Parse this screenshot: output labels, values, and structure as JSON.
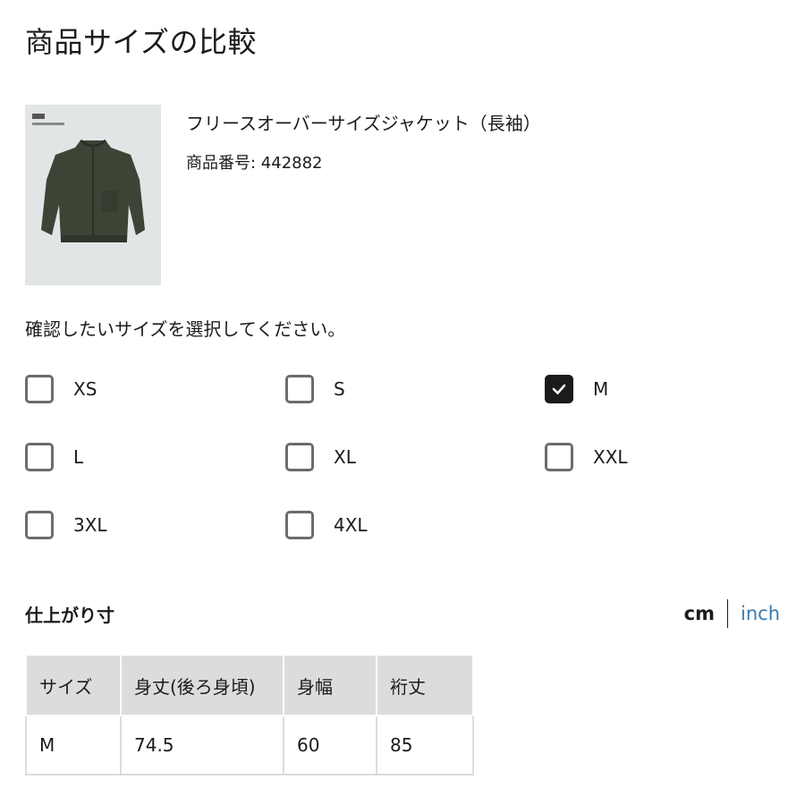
{
  "page": {
    "title": "商品サイズの比較"
  },
  "product": {
    "name": "フリースオーバーサイズジャケット（長袖）",
    "number_label": "商品番号: 442882"
  },
  "selector": {
    "prompt": "確認したいサイズを選択してください。",
    "sizes": [
      {
        "label": "XS",
        "checked": false
      },
      {
        "label": "S",
        "checked": false
      },
      {
        "label": "M",
        "checked": true
      },
      {
        "label": "L",
        "checked": false
      },
      {
        "label": "XL",
        "checked": false
      },
      {
        "label": "XXL",
        "checked": false
      },
      {
        "label": "3XL",
        "checked": false
      },
      {
        "label": "4XL",
        "checked": false
      }
    ]
  },
  "measurements": {
    "title": "仕上がり寸",
    "unit_cm": "cm",
    "unit_inch": "inch",
    "headers": [
      "サイズ",
      "身丈(後ろ身頃)",
      "身幅",
      "裄丈"
    ],
    "rows": [
      [
        "M",
        "74.5",
        "60",
        "85"
      ]
    ]
  },
  "colors": {
    "accent_link": "#3a7bb0",
    "checkbox_checked": "#1b1b1b",
    "table_header_bg": "#dcdcdc"
  },
  "icons": {
    "checkmark": "check-icon"
  }
}
